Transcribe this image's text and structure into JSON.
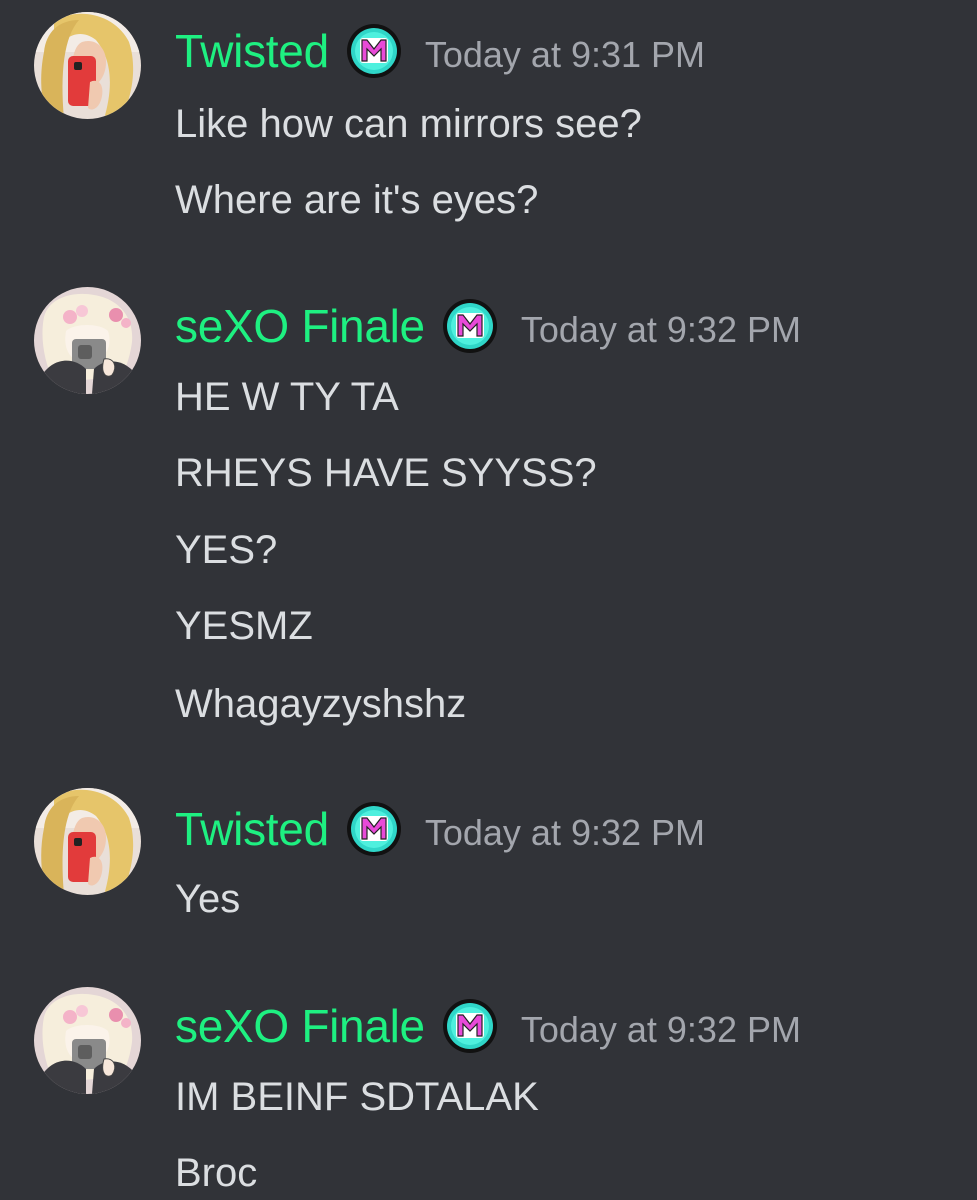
{
  "messages": [
    {
      "author": "Twisted",
      "avatar_icon": "blonde-mirror-selfie-avatar",
      "badge_icon": "m-badge-icon",
      "timestamp": "Today at 9:31 PM",
      "lines": [
        "Like how can mirrors see?",
        "Where are it's eyes?"
      ]
    },
    {
      "author": "seXO Finale",
      "avatar_icon": "cartoon-girl-phone-avatar",
      "badge_icon": "m-badge-icon",
      "timestamp": "Today at 9:32 PM",
      "lines": [
        "HE W TY TA",
        "RHEYS HAVE SYYSS?",
        "YES?",
        "YESMZ",
        "Whagayzyshshz"
      ]
    },
    {
      "author": "Twisted",
      "avatar_icon": "blonde-mirror-selfie-avatar",
      "badge_icon": "m-badge-icon",
      "timestamp": "Today at 9:32 PM",
      "lines": [
        "Yes"
      ]
    },
    {
      "author": "seXO Finale",
      "avatar_icon": "cartoon-girl-phone-avatar",
      "badge_icon": "m-badge-icon",
      "timestamp": "Today at 9:32 PM",
      "lines": [
        "IM BEINF SDTALAK",
        "Broc"
      ]
    }
  ],
  "colors": {
    "background": "#313338",
    "username": "#1ef081",
    "timestamp": "#a3a6ad",
    "text": "#dbdee1",
    "badge_ring": "#111111",
    "badge_fill": "#35e0d0",
    "badge_letter": "#e84ad8"
  }
}
